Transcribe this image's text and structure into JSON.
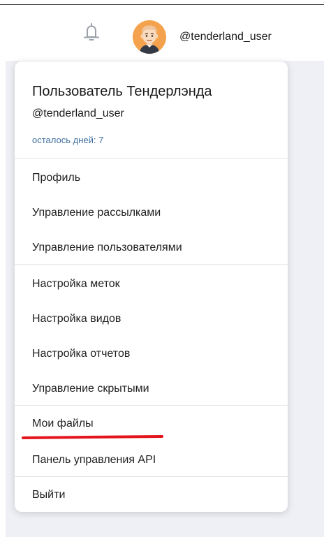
{
  "header": {
    "username": "@tenderland_user",
    "bell_icon": "bell-icon",
    "avatar_icon": "avatar"
  },
  "menu": {
    "full_name": "Пользователь Тендерлэнда",
    "handle": "@tenderland_user",
    "days_left": "осталось дней: 7",
    "groups": [
      [
        "Профиль",
        "Управление рассылками",
        "Управление пользователями"
      ],
      [
        "Настройка меток",
        "Настройка видов",
        "Настройка отчетов",
        "Управление скрытыми"
      ],
      [
        "Мои файлы",
        "Панель управления API"
      ],
      [
        "Выйти"
      ]
    ]
  },
  "colors": {
    "page_background": "#eef0f5",
    "highlight_underline": "#e3141c",
    "days_left_text": "#3f6f9f"
  }
}
